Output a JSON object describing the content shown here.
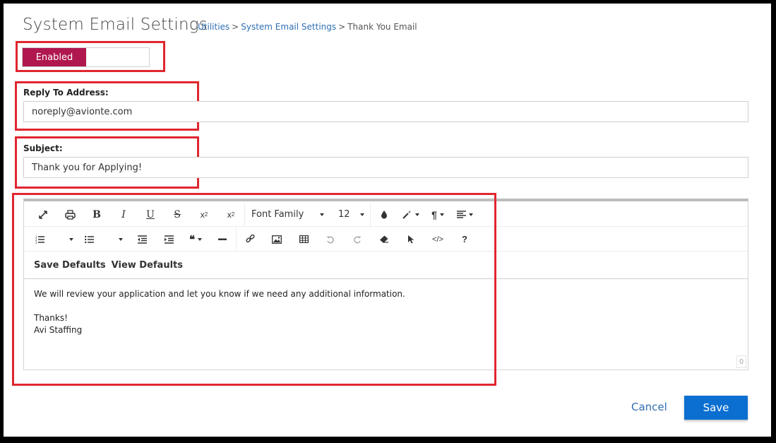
{
  "header": {
    "title": "System Email Settings",
    "breadcrumb": [
      {
        "label": "Utilities"
      },
      {
        "label": "System Email Settings"
      },
      {
        "label": "Thank You Email"
      }
    ],
    "separator": ">"
  },
  "toggle": {
    "label": "Enabled",
    "state": "on",
    "color": "#b0174e"
  },
  "reply_to": {
    "label": "Reply To Address:",
    "value": "noreply@avionte.com"
  },
  "subject": {
    "label": "Subject:",
    "value": "Thank you for Applying!"
  },
  "editor": {
    "toolbar": {
      "font_family": "Font Family",
      "font_size": "12",
      "row1_icons": [
        "fullscreen-icon",
        "print-icon",
        "bold-icon",
        "italic-icon",
        "underline-icon",
        "strikethrough-icon",
        "subscript-icon",
        "superscript-icon",
        "font-family-dropdown",
        "font-size-dropdown",
        "font-color-icon",
        "magic-wand-icon",
        "paragraph-icon",
        "align-icon"
      ],
      "row2_icons": [
        "ordered-list-icon",
        "unordered-list-icon",
        "outdent-icon",
        "indent-icon",
        "quote-icon",
        "horizontal-rule-icon",
        "link-icon",
        "image-icon",
        "table-icon",
        "undo-icon",
        "redo-icon",
        "eraser-icon",
        "select-icon",
        "code-view-icon",
        "help-icon"
      ]
    },
    "save_defaults": "Save Defaults",
    "view_defaults": "View Defaults",
    "body_lines": [
      "We will review your application and let you know if we need any additional information.",
      "",
      "Thanks!",
      "Avi Staffing"
    ],
    "char_count": "0"
  },
  "actions": {
    "cancel": "Cancel",
    "save": "Save",
    "save_color": "#0b6fd1"
  },
  "annotation_color": "#e0262f"
}
